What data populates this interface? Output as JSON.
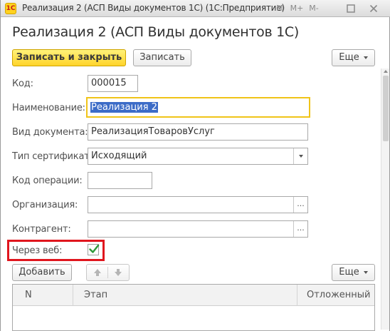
{
  "window": {
    "title": "Реализация 2 (АСП Виды документов 1С)  (1С:Предприятие)",
    "app_icon_text": "1С",
    "controls": [
      "M",
      "M+",
      "M-",
      "□",
      "×"
    ]
  },
  "page": {
    "title": "Реализация 2 (АСП Виды документов 1С)"
  },
  "toolbar": {
    "save_close_label": "Записать и закрыть",
    "save_label": "Записать",
    "more_label": "Еще"
  },
  "form": {
    "code": {
      "label": "Код:",
      "value": "000015"
    },
    "name": {
      "label": "Наименование:",
      "value": "Реализация 2"
    },
    "doc_type": {
      "label": "Вид документа:",
      "value": "РеализацияТоваровУслуг"
    },
    "cert_type": {
      "label": "Тип сертификата:",
      "value": "Исходящий"
    },
    "op_code": {
      "label": "Код операции:",
      "value": ""
    },
    "organization": {
      "label": "Организация:",
      "value": "",
      "select_label": "..."
    },
    "counterparty": {
      "label": "Контрагент:",
      "value": "",
      "select_label": "..."
    },
    "via_web": {
      "label": "Через веб:",
      "checked": true
    }
  },
  "table_toolbar": {
    "add_label": "Добавить",
    "more_label": "Еще"
  },
  "table": {
    "columns": [
      "N",
      "Этап",
      "Отложенный"
    ],
    "rows": []
  },
  "colors": {
    "primary_button": "#ffd42a",
    "focus_border": "#f0c419",
    "selection": "#3c6cc7",
    "highlight_frame": "#e0161e",
    "checkmark": "#2e9a3a"
  }
}
